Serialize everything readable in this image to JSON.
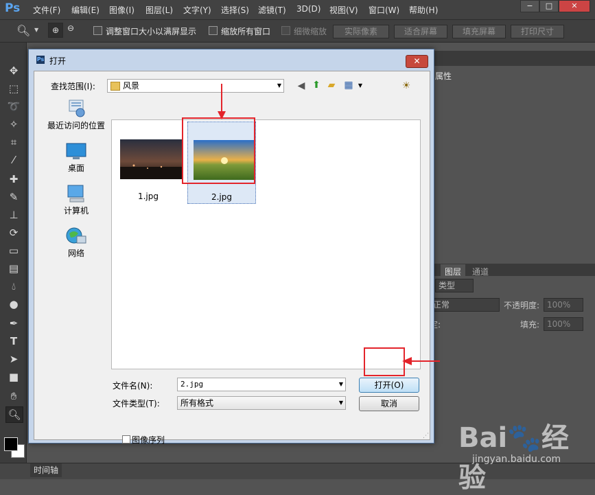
{
  "app": {
    "logo": "Ps",
    "menu": [
      "文件(F)",
      "编辑(E)",
      "图像(I)",
      "图层(L)",
      "文字(Y)",
      "选择(S)",
      "滤镜(T)",
      "3D(D)",
      "视图(V)",
      "窗口(W)",
      "帮助(H)"
    ],
    "window_buttons": [
      "−",
      "□",
      "✕"
    ]
  },
  "options_bar": {
    "resize_windows_label": "调整窗口大小以满屏显示",
    "zoom_all_label": "缩放所有窗口",
    "scrubby_zoom_label": "细微缩放",
    "actual_pixels": "实际像素",
    "fit_screen": "适合屏幕",
    "fill_screen": "填充屏幕",
    "print_size": "打印尺寸"
  },
  "right_panel": {
    "properties_tab": "属性",
    "layers_tab": "图层",
    "channels_tab": "通道",
    "kind_label": "类型",
    "blend_mode": "正常",
    "opacity_label": "不透明度:",
    "opacity_value": "100%",
    "lock_label": "定:",
    "fill_label": "填充:",
    "fill_value": "100%"
  },
  "timeline_tab": "时间轴",
  "dialog": {
    "title": "打开",
    "close": "✕",
    "look_in_label": "查找范围(I):",
    "look_in_value": "风景",
    "places": [
      "最近访问的位置",
      "桌面",
      "计算机",
      "网络"
    ],
    "files": [
      {
        "name": "1.jpg",
        "selected": false
      },
      {
        "name": "2.jpg",
        "selected": true
      }
    ],
    "file_name_label": "文件名(N):",
    "file_name_value": "2.jpg",
    "file_type_label": "文件类型(T):",
    "file_type_value": "所有格式",
    "open_button": "打开(O)",
    "cancel_button": "取消",
    "image_sequence_label": "图像序列"
  },
  "watermark": {
    "logo": "Bai🐾经验",
    "url": "jingyan.baidu.com"
  },
  "colors": {
    "workspace_bg": "#535353",
    "menubar_bg": "#424242",
    "dialog_frame": "#c5d5ea",
    "callout_red": "#e3242b",
    "ps_blue": "#5ba5f0"
  }
}
